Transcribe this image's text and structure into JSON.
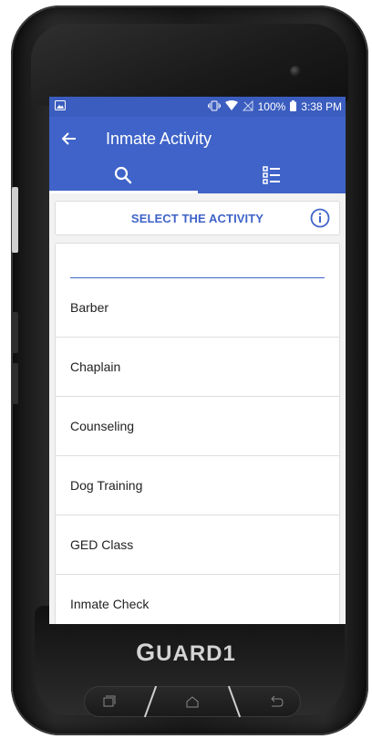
{
  "device": {
    "brand_prefix": "G",
    "brand_rest": "UARD1"
  },
  "status_bar": {
    "battery": "100%",
    "time": "3:38 PM"
  },
  "app_bar": {
    "title": "Inmate Activity"
  },
  "tabs": [
    {
      "icon": "search-icon",
      "active": true
    },
    {
      "icon": "list-icon",
      "active": false
    }
  ],
  "select_header": {
    "label": "SELECT THE ACTIVITY",
    "icon": "info-icon"
  },
  "search": {
    "value": ""
  },
  "activities": [
    {
      "label": "Barber"
    },
    {
      "label": "Chaplain"
    },
    {
      "label": "Counseling"
    },
    {
      "label": "Dog Training"
    },
    {
      "label": "GED Class"
    },
    {
      "label": "Inmate Check"
    }
  ],
  "colors": {
    "primary": "#3f63c8",
    "status_bar": "#3b5dbf"
  }
}
